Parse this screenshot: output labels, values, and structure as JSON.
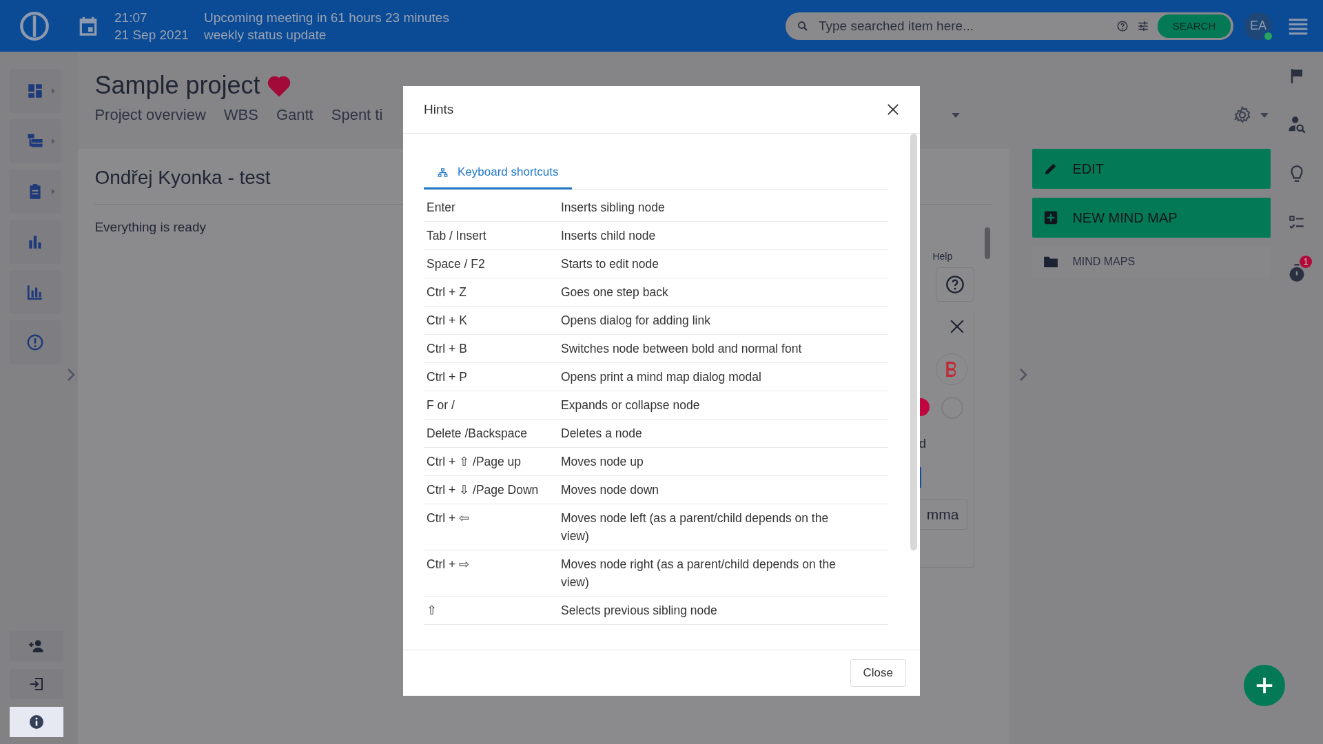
{
  "topbar": {
    "time": "21:07",
    "meeting": "Upcoming meeting in 61 hours 23 minutes",
    "date": "21 Sep 2021",
    "event": "weekly status update",
    "search": {
      "placeholder": "Type searched item here..."
    },
    "search_button": "SEARCH",
    "avatar": "EA",
    "online": true
  },
  "sidebar": {
    "bottom_items": [
      {
        "selected": false
      },
      {
        "selected": false
      },
      {
        "selected": true
      }
    ]
  },
  "project": {
    "title": "Sample project",
    "favorite": true,
    "tabs": [
      {
        "label": "Project overview"
      },
      {
        "label": "WBS"
      },
      {
        "label": "Gantt"
      },
      {
        "label": "Spent ti"
      }
    ]
  },
  "card": {
    "title": "Ondřej Kyonka - test",
    "status": "Everything is ready",
    "help_label": "Help",
    "partial_label": "d",
    "partial_field": "mma"
  },
  "side_panel": {
    "buttons": [
      {
        "label": "EDIT",
        "kind": "edit"
      },
      {
        "label": "NEW MIND MAP",
        "kind": "new"
      }
    ],
    "folder": "MIND MAPS"
  },
  "rail": {
    "timer_badge": "1"
  },
  "modal": {
    "title": "Hints",
    "tabs": [
      {
        "label": "Keyboard shortcuts",
        "selected": true
      }
    ],
    "shortcuts": [
      {
        "keys": "Enter",
        "action": "Inserts sibling node"
      },
      {
        "keys": "Tab / Insert",
        "action": "Inserts child node"
      },
      {
        "keys": "Space / F2",
        "action": "Starts to edit node"
      },
      {
        "keys": "Ctrl + Z",
        "action": "Goes one step back"
      },
      {
        "keys": "Ctrl + K",
        "action": "Opens dialog for adding link"
      },
      {
        "keys": "Ctrl + B",
        "action": "Switches node between bold and normal font"
      },
      {
        "keys": "Ctrl + P",
        "action": "Opens print a mind map dialog modal"
      },
      {
        "keys": "F or /",
        "action": "Expands or collapse node"
      },
      {
        "keys": "Delete /Backspace",
        "action": "Deletes a node"
      },
      {
        "keys": "Ctrl + ⇧ /Page up",
        "action": "Moves node up"
      },
      {
        "keys": "Ctrl + ⇩ /Page Down",
        "action": "Moves node down"
      },
      {
        "keys": "Ctrl + ⇦",
        "action": "Moves node left (as a parent/child depends on the view)"
      },
      {
        "keys": "Ctrl + ⇨",
        "action": "Moves node right (as a parent/child depends on the view)"
      },
      {
        "keys": "⇧",
        "action": "Selects previous sibling node"
      }
    ],
    "close_button": "Close"
  }
}
